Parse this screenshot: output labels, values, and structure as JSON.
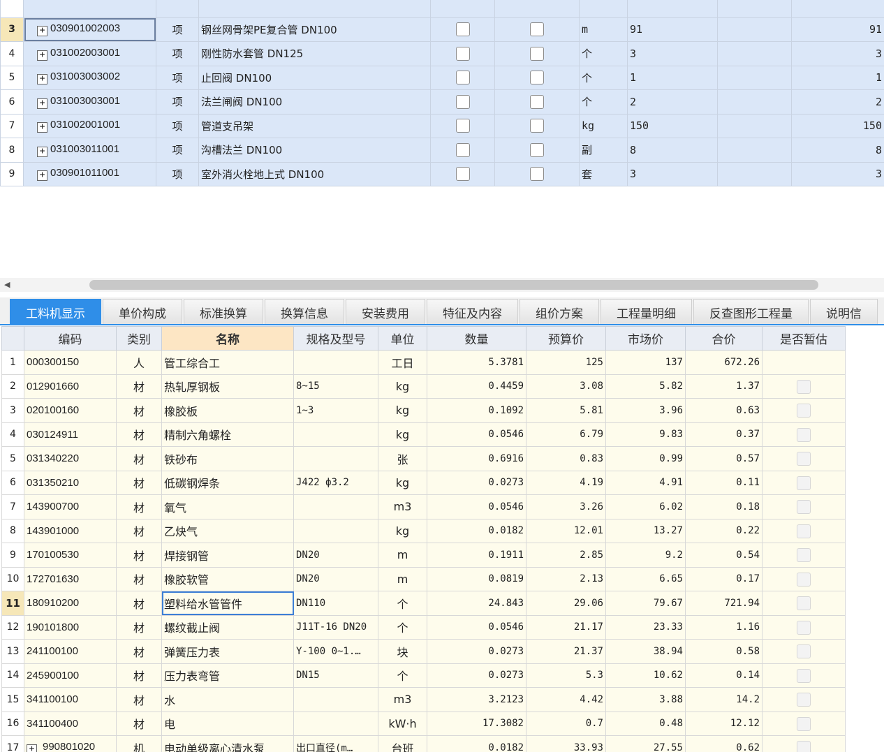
{
  "top_grid": {
    "rows": [
      {
        "num": "3",
        "code": "030901002003",
        "type": "项",
        "name": "钢丝网骨架PE复合管 DN100",
        "unit": "m",
        "qty": "91",
        "total": "91",
        "current": true
      },
      {
        "num": "4",
        "code": "031002003001",
        "type": "项",
        "name": "刚性防水套管 DN125",
        "unit": "个",
        "qty": "3",
        "total": "3"
      },
      {
        "num": "5",
        "code": "031003003002",
        "type": "项",
        "name": "止回阀 DN100",
        "unit": "个",
        "qty": "1",
        "total": "1"
      },
      {
        "num": "6",
        "code": "031003003001",
        "type": "项",
        "name": "法兰闸阀 DN100",
        "unit": "个",
        "qty": "2",
        "total": "2"
      },
      {
        "num": "7",
        "code": "031002001001",
        "type": "项",
        "name": "管道支吊架",
        "unit": "kg",
        "qty": "150",
        "total": "150"
      },
      {
        "num": "8",
        "code": "031003011001",
        "type": "项",
        "name": "沟槽法兰 DN100",
        "unit": "副",
        "qty": "8",
        "total": "8"
      },
      {
        "num": "9",
        "code": "030901011001",
        "type": "项",
        "name": "室外消火栓地上式 DN100",
        "unit": "套",
        "qty": "3",
        "total": "3"
      }
    ]
  },
  "tabs": [
    "工料机显示",
    "单价构成",
    "标准换算",
    "换算信息",
    "安装费用",
    "特征及内容",
    "组价方案",
    "工程量明细",
    "反查图形工程量",
    "说明信"
  ],
  "bottom_grid": {
    "headers": [
      "编码",
      "类别",
      "名称",
      "规格及型号",
      "单位",
      "数量",
      "预算价",
      "市场价",
      "合价",
      "是否暂估"
    ],
    "rows": [
      {
        "num": "1",
        "code": "000300150",
        "cat": "人",
        "name": "管工综合工",
        "spec": "",
        "unit": "工日",
        "qty": "5.3781",
        "budget": "125",
        "market": "137",
        "total": "672.26",
        "chk": false
      },
      {
        "num": "2",
        "code": "012901660",
        "cat": "材",
        "name": "热轧厚钢板",
        "spec": "8~15",
        "unit": "kg",
        "qty": "0.4459",
        "budget": "3.08",
        "market": "5.82",
        "total": "1.37",
        "chk": true
      },
      {
        "num": "3",
        "code": "020100160",
        "cat": "材",
        "name": "橡胶板",
        "spec": "1~3",
        "unit": "kg",
        "qty": "0.1092",
        "budget": "5.81",
        "market": "3.96",
        "total": "0.63",
        "chk": true
      },
      {
        "num": "4",
        "code": "030124911",
        "cat": "材",
        "name": "精制六角螺栓",
        "spec": "",
        "unit": "kg",
        "qty": "0.0546",
        "budget": "6.79",
        "market": "9.83",
        "total": "0.37",
        "chk": true
      },
      {
        "num": "5",
        "code": "031340220",
        "cat": "材",
        "name": "铁砂布",
        "spec": "",
        "unit": "张",
        "qty": "0.6916",
        "budget": "0.83",
        "market": "0.99",
        "total": "0.57",
        "chk": true
      },
      {
        "num": "6",
        "code": "031350210",
        "cat": "材",
        "name": "低碳钢焊条",
        "spec": "J422 ф3.2",
        "unit": "kg",
        "qty": "0.0273",
        "budget": "4.19",
        "market": "4.91",
        "total": "0.11",
        "chk": true
      },
      {
        "num": "7",
        "code": "143900700",
        "cat": "材",
        "name": "氧气",
        "spec": "",
        "unit": "m3",
        "qty": "0.0546",
        "budget": "3.26",
        "market": "6.02",
        "total": "0.18",
        "chk": true
      },
      {
        "num": "8",
        "code": "143901000",
        "cat": "材",
        "name": "乙炔气",
        "spec": "",
        "unit": "kg",
        "qty": "0.0182",
        "budget": "12.01",
        "market": "13.27",
        "total": "0.22",
        "chk": true
      },
      {
        "num": "9",
        "code": "170100530",
        "cat": "材",
        "name": "焊接钢管",
        "spec": "DN20",
        "unit": "m",
        "qty": "0.1911",
        "budget": "2.85",
        "market": "9.2",
        "total": "0.54",
        "chk": true
      },
      {
        "num": "10",
        "code": "172701630",
        "cat": "材",
        "name": "橡胶软管",
        "spec": "DN20",
        "unit": "m",
        "qty": "0.0819",
        "budget": "2.13",
        "market": "6.65",
        "total": "0.17",
        "chk": true
      },
      {
        "num": "11",
        "code": "180910200",
        "cat": "材",
        "name": "塑料给水管管件",
        "spec": "DN110",
        "unit": "个",
        "qty": "24.843",
        "budget": "29.06",
        "market": "79.67",
        "total": "721.94",
        "chk": true,
        "current": true
      },
      {
        "num": "12",
        "code": "190101800",
        "cat": "材",
        "name": "螺纹截止阀",
        "spec": "J11T-16 DN20",
        "unit": "个",
        "qty": "0.0546",
        "budget": "21.17",
        "market": "23.33",
        "total": "1.16",
        "chk": true
      },
      {
        "num": "13",
        "code": "241100100",
        "cat": "材",
        "name": "弹簧压力表",
        "spec": "Y-100 0~1.…",
        "unit": "块",
        "qty": "0.0273",
        "budget": "21.37",
        "market": "38.94",
        "total": "0.58",
        "chk": true
      },
      {
        "num": "14",
        "code": "245900100",
        "cat": "材",
        "name": "压力表弯管",
        "spec": "DN15",
        "unit": "个",
        "qty": "0.0273",
        "budget": "5.3",
        "market": "10.62",
        "total": "0.14",
        "chk": true
      },
      {
        "num": "15",
        "code": "341100100",
        "cat": "材",
        "name": "水",
        "spec": "",
        "unit": "m3",
        "qty": "3.2123",
        "budget": "4.42",
        "market": "3.88",
        "total": "14.2",
        "chk": true
      },
      {
        "num": "16",
        "code": "341100400",
        "cat": "材",
        "name": "电",
        "spec": "",
        "unit": "kW·h",
        "qty": "17.3082",
        "budget": "0.7",
        "market": "0.48",
        "total": "12.12",
        "chk": true
      },
      {
        "num": "17",
        "code": "990801020",
        "cat": "机",
        "name": "电动单级离心清水泵",
        "spec": "出口直径(m…",
        "unit": "台班",
        "qty": "0.0182",
        "budget": "33.93",
        "market": "27.55",
        "total": "0.62",
        "chk": true,
        "expand": true
      }
    ]
  }
}
